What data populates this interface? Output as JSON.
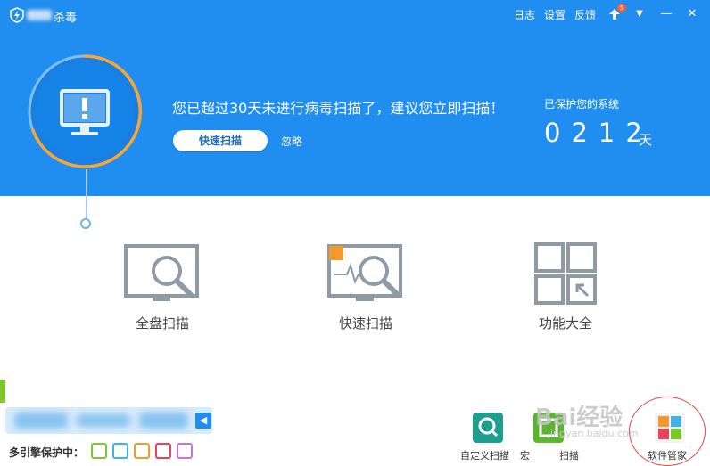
{
  "window": {
    "app_title": "杀毒",
    "menu": {
      "log": "日志",
      "settings": "设置",
      "feedback": "反馈"
    },
    "upgrade_badge": "5",
    "controls": {
      "dropdown": "▼",
      "minimize": "—",
      "close": "✕"
    }
  },
  "status": {
    "message": "您已超过30天未进行病毒扫描了，建议您立即扫描！",
    "quick_scan_button": "快速扫描",
    "ignore_link": "忽略",
    "protected_label": "已保护您的系统",
    "days": "0212",
    "days_unit": "天",
    "alert_icon": "monitor-alert-icon"
  },
  "features": [
    {
      "label": "全盘扫描",
      "icon": "full-scan-icon"
    },
    {
      "label": "快速扫描",
      "icon": "quick-scan-icon",
      "tag": "荐"
    },
    {
      "label": "功能大全",
      "icon": "all-features-icon"
    }
  ],
  "engines": {
    "label": "多引擎保护中：",
    "icons": [
      "cloud-engine-icon",
      "qvm-engine-icon",
      "system-repair-engine-icon",
      "avira-engine-icon",
      "bitdefender-engine-icon"
    ]
  },
  "tools": [
    {
      "label": "自定义扫描",
      "icon": "custom-scan-icon"
    },
    {
      "label": "宏",
      "label_tail": "扫描",
      "icon": "macro-scan-icon"
    },
    {
      "label": "软件管家",
      "icon": "software-manager-icon"
    }
  ],
  "watermark": {
    "text": "Bai经验",
    "sub": "jingyan.baidu.com"
  },
  "colors": {
    "header_blue": "#1f8ef0",
    "ring_orange": "#f7a533",
    "icon_gray": "#8e9aa6",
    "link_blue": "#1d6fc4"
  }
}
